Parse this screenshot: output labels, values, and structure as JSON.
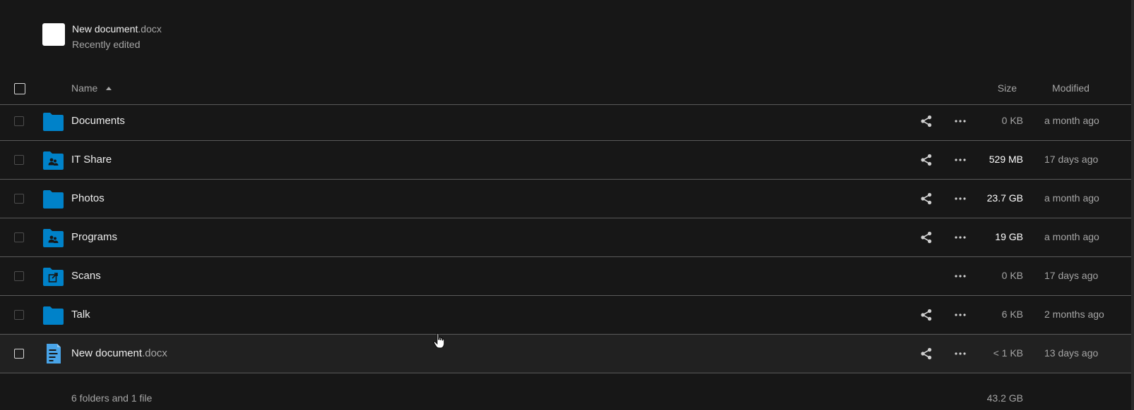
{
  "recent": {
    "name": "New document",
    "ext": ".docx",
    "subtitle": "Recently edited"
  },
  "table": {
    "headers": {
      "name": "Name",
      "size": "Size",
      "modified": "Modified"
    },
    "rows": [
      {
        "name": "Documents",
        "ext": "",
        "size": "0 KB",
        "modified": "a month ago",
        "icon": "folder-icon",
        "shareable": true
      },
      {
        "name": "IT Share",
        "ext": "",
        "size": "529 MB",
        "modified": "17 days ago",
        "icon": "shared-folder-icon",
        "shareable": true
      },
      {
        "name": "Photos",
        "ext": "",
        "size": "23.7 GB",
        "modified": "a month ago",
        "icon": "folder-icon",
        "shareable": true
      },
      {
        "name": "Programs",
        "ext": "",
        "size": "19 GB",
        "modified": "a month ago",
        "icon": "shared-folder-icon",
        "shareable": true
      },
      {
        "name": "Scans",
        "ext": "",
        "size": "0 KB",
        "modified": "17 days ago",
        "icon": "external-folder-icon",
        "shareable": false
      },
      {
        "name": "Talk",
        "ext": "",
        "size": "6 KB",
        "modified": "2 months ago",
        "icon": "folder-icon",
        "shareable": true
      },
      {
        "name": "New document",
        "ext": ".docx",
        "size": "< 1 KB",
        "modified": "13 days ago",
        "icon": "document-icon",
        "shareable": true
      }
    ]
  },
  "footer": {
    "summary": "6 folders and 1 file",
    "total_size": "43.2 GB"
  },
  "colors": {
    "background": "#171717",
    "folder_blue": "#0082c9",
    "document_blue": "#49a4e8",
    "divider": "#5a5a5a",
    "muted_text": "#a5a5a5"
  }
}
